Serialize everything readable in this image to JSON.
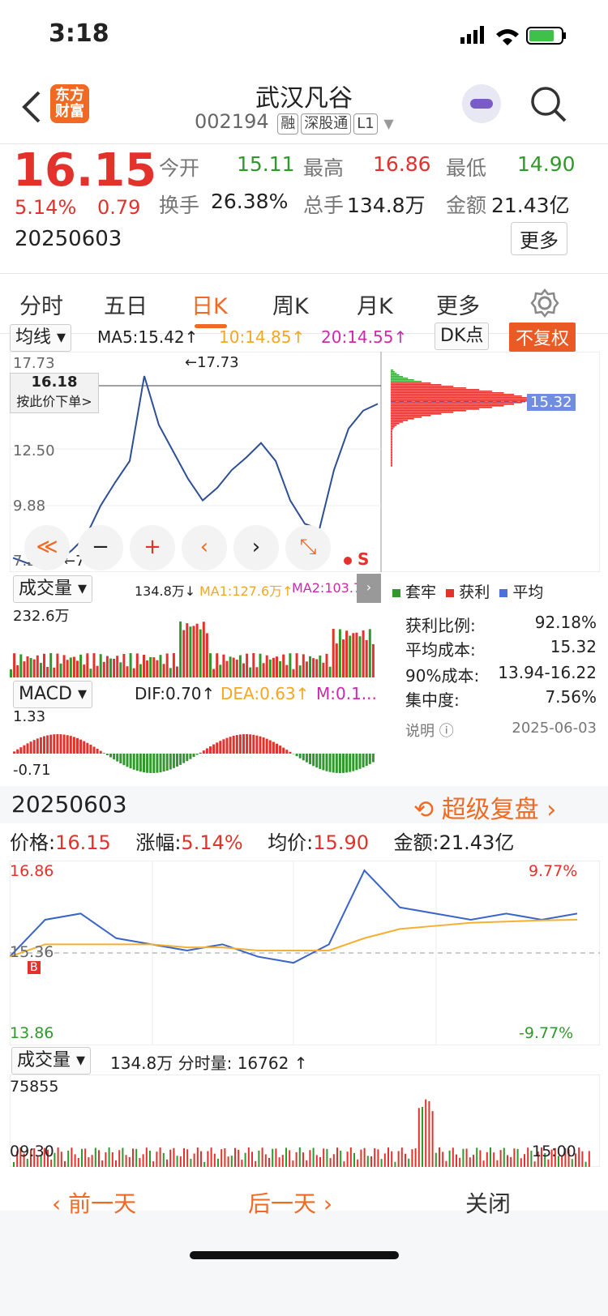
{
  "status": {
    "time": "3:18"
  },
  "header": {
    "logo_line1": "东方",
    "logo_line2": "财富",
    "stock_name": "武汉凡谷",
    "code": "002194",
    "tags": [
      "融",
      "深股通",
      "L1"
    ]
  },
  "quote": {
    "price": "16.15",
    "change_pct": "5.14%",
    "change_amt": "0.79",
    "date": "20250603",
    "open_label": "今开",
    "open": "15.11",
    "high_label": "最高",
    "high": "16.86",
    "low_label": "最低",
    "low": "14.90",
    "turnover_label": "换手",
    "turnover": "26.38%",
    "volume_label": "总手",
    "volume": "134.8万",
    "amount_label": "金额",
    "amount": "21.43亿",
    "more": "更多"
  },
  "tabs": [
    {
      "label": "分时"
    },
    {
      "label": "五日"
    },
    {
      "label": "日K"
    },
    {
      "label": "周K"
    },
    {
      "label": "月K"
    },
    {
      "label": "更多"
    }
  ],
  "kline": {
    "ma_select": "均线",
    "ma5": "MA5:15.42↑",
    "ma10": "10:14.85↑",
    "ma20": "20:14.55↑",
    "dk": "DK点",
    "fq": "不复权",
    "y_top": "17.73",
    "y_mid": "12.50",
    "y_low": "9.88",
    "y_bot": "7.26",
    "peak_label": "←17.73",
    "low_label": "←7.26",
    "hover_price": "16.18",
    "hover_action": "按此价下单>",
    "cost_price": "15.32",
    "sell_marker": "S"
  },
  "volume_panel": {
    "select": "成交量",
    "value": "134.8万↓",
    "ma1": "MA1:127.6万↑",
    "ma2": "MA2:103.7...",
    "y_top": "232.6万"
  },
  "macd_panel": {
    "select": "MACD",
    "dif": "DIF:0.70↑",
    "dea": "DEA:0.63↑",
    "m": "M:0.1...",
    "y_top": "1.33",
    "y_bot": "-0.71"
  },
  "chip": {
    "legend": [
      "套牢",
      "获利",
      "平均"
    ],
    "rows": [
      [
        "获利比例:",
        "92.18%"
      ],
      [
        "平均成本:",
        "15.32"
      ],
      [
        "90%成本:",
        "13.94-16.22"
      ],
      [
        "集中度:",
        "7.56%"
      ]
    ],
    "note_label": "说明",
    "note_date": "2025-06-03"
  },
  "replay": {
    "date": "20250603",
    "title": "超级复盘",
    "price_label": "价格:",
    "price": "16.15",
    "chg_label": "涨幅:",
    "chg": "5.14%",
    "avg_label": "均价:",
    "avg": "15.90",
    "amt_label": "金额:",
    "amt": "21.43亿"
  },
  "intraday": {
    "y_top": "16.86",
    "y_mid": "15.36",
    "y_bot": "13.86",
    "pct_top": "9.77%",
    "pct_bot": "-9.77%",
    "buy_marker": "B"
  },
  "intraday_vol": {
    "select": "成交量",
    "summary": "134.8万 分时量: 16762 ↑",
    "y_top": "75855",
    "t_start": "09:30",
    "t_end": "15:00"
  },
  "footer": {
    "prev": "前一天",
    "next": "后一天",
    "close": "关闭"
  },
  "chart_data": [
    {
      "type": "line",
      "title": "日K",
      "series": [
        {
          "name": "价格",
          "values": [
            7.6,
            7.3,
            7.5,
            7.4,
            8.0,
            8.8,
            10.5,
            11.8,
            13.0,
            17.73,
            15.0,
            13.5,
            12.0,
            10.8,
            11.5,
            12.5,
            13.2,
            14.0,
            13.0,
            10.8,
            9.5,
            9.2,
            12.5,
            14.8,
            15.8,
            16.18
          ]
        }
      ],
      "ylim": [
        7.26,
        17.73
      ]
    },
    {
      "type": "line",
      "title": "分时",
      "series": [
        {
          "name": "价格",
          "values": [
            15.3,
            15.9,
            16.0,
            15.6,
            15.5,
            15.4,
            15.5,
            15.3,
            15.2,
            15.5,
            16.7,
            16.1,
            16.0,
            15.9,
            16.0,
            15.9,
            16.0
          ]
        },
        {
          "name": "均价",
          "values": [
            15.3,
            15.5,
            15.5,
            15.5,
            15.5,
            15.45,
            15.45,
            15.4,
            15.4,
            15.4,
            15.6,
            15.75,
            15.8,
            15.85,
            15.87,
            15.89,
            15.9
          ]
        }
      ],
      "ylim": [
        13.86,
        16.86
      ]
    }
  ]
}
